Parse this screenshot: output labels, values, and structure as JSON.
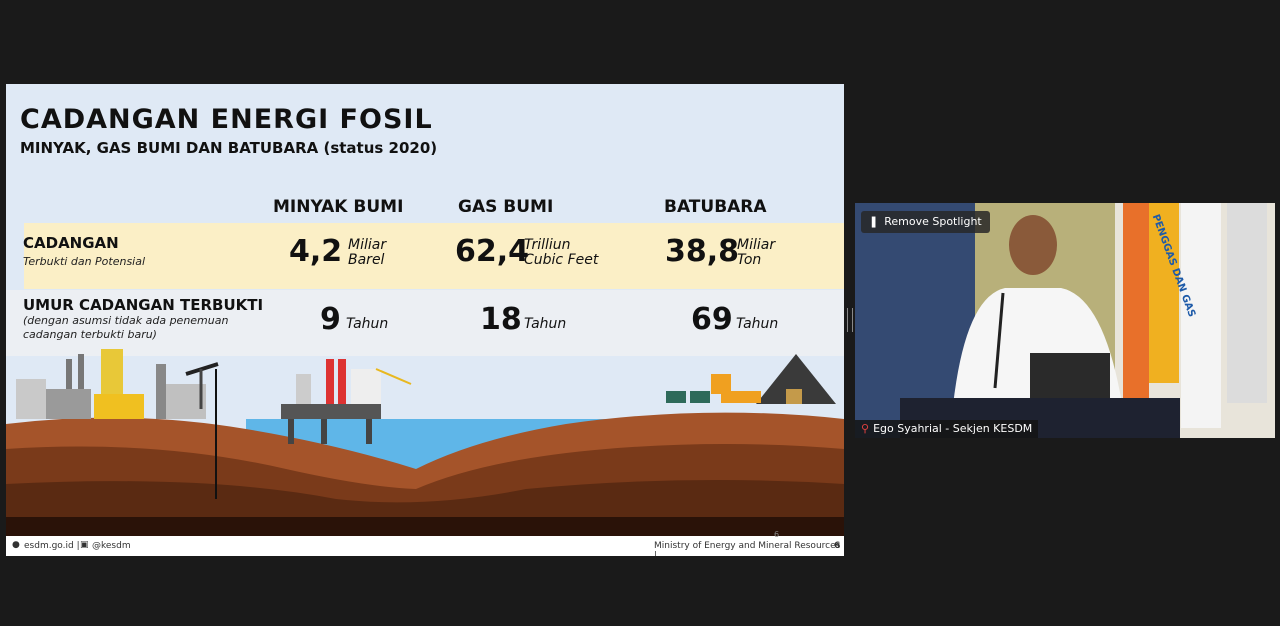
{
  "slide": {
    "title": "CADANGAN ENERGI FOSIL",
    "subtitle": "MINYAK, GAS BUMI DAN BATUBARA (status 2020)",
    "columns": [
      "MINYAK BUMI",
      "GAS BUMI",
      "BATUBARA"
    ],
    "rows": [
      {
        "label": "CADANGAN",
        "note": "Terbukti dan Potensial",
        "values": [
          {
            "value": "4,2",
            "unit1": "Miliar",
            "unit2": "Barel"
          },
          {
            "value": "62,4",
            "unit1": "Trilliun",
            "unit2": "Cubic Feet"
          },
          {
            "value": "38,8",
            "unit1": "Miliar",
            "unit2": "Ton"
          }
        ]
      },
      {
        "label": "UMUR CADANGAN TERBUKTI",
        "note1": "(dengan asumsi tidak ada penemuan",
        "note2": "cadangan terbukti baru)",
        "values": [
          {
            "value": "9",
            "unit": "Tahun"
          },
          {
            "value": "18",
            "unit": "Tahun"
          },
          {
            "value": "69",
            "unit": "Tahun"
          }
        ]
      }
    ],
    "footer": {
      "website": "esdm.go.id |",
      "social": "@kesdm",
      "ministry": "Ministry of Energy and Mineral Resources |",
      "page": "6",
      "page_small": "6"
    }
  },
  "video": {
    "remove_spotlight": "Remove Spotlight",
    "participant": "Ego Syahrial - Sekjen KESDM",
    "flag_text": "PENGGAS DAN GAS"
  },
  "colors": {
    "background": "#1a1a1a",
    "slide_bg": "#dfe9f5",
    "row_highlight": "#fbefc6",
    "ground": "#7a3a1a",
    "water": "#5fb6e8"
  }
}
